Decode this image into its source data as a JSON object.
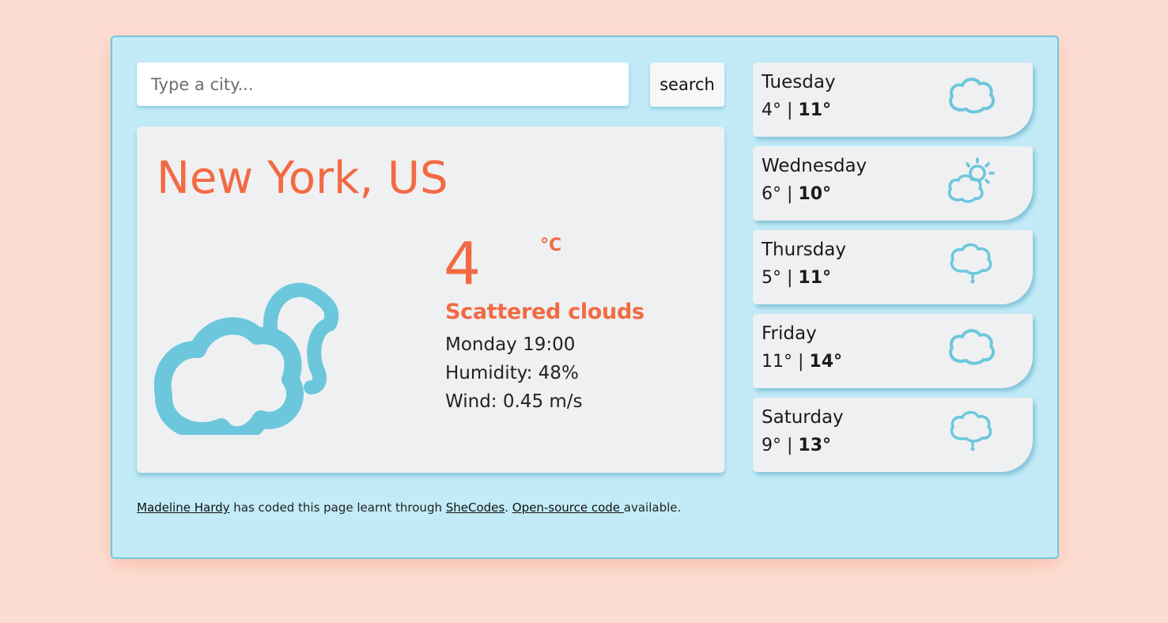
{
  "search": {
    "placeholder": "Type a city...",
    "button_label": "search"
  },
  "current": {
    "city": "New York, US",
    "temperature": "4",
    "unit": "°C",
    "description": "Scattered clouds",
    "datetime": "Monday 19:00",
    "humidity": "Humidity: 48%",
    "wind": "Wind: 0.45 m/s",
    "icon": "cloud-moon-icon"
  },
  "forecast": [
    {
      "day": "Tuesday",
      "min": "4°",
      "sep": " | ",
      "max": "11°",
      "icon": "cloud-icon"
    },
    {
      "day": "Wednesday",
      "min": "6°",
      "sep": " | ",
      "max": "10°",
      "icon": "cloud-sun-icon"
    },
    {
      "day": "Thursday",
      "min": "5°",
      "sep": " | ",
      "max": "11°",
      "icon": "cloud-drizzle-icon"
    },
    {
      "day": "Friday",
      "min": "11°",
      "sep": " | ",
      "max": "14°",
      "icon": "cloud-icon"
    },
    {
      "day": "Saturday",
      "min": "9°",
      "sep": " | ",
      "max": "13°",
      "icon": "cloud-drizzle-icon"
    }
  ],
  "footer": {
    "author_link": "Madeline Hardy",
    "text_1": " has coded this page learnt through ",
    "school_link": "SheCodes",
    "text_2": ". ",
    "source_link": "Open-source code ",
    "text_3": "available."
  },
  "colors": {
    "background": "#fdddd3",
    "panel": "#c2ebf7",
    "card": "#eff0f2",
    "accent": "#f26a43",
    "icon": "#6cc7dc"
  }
}
